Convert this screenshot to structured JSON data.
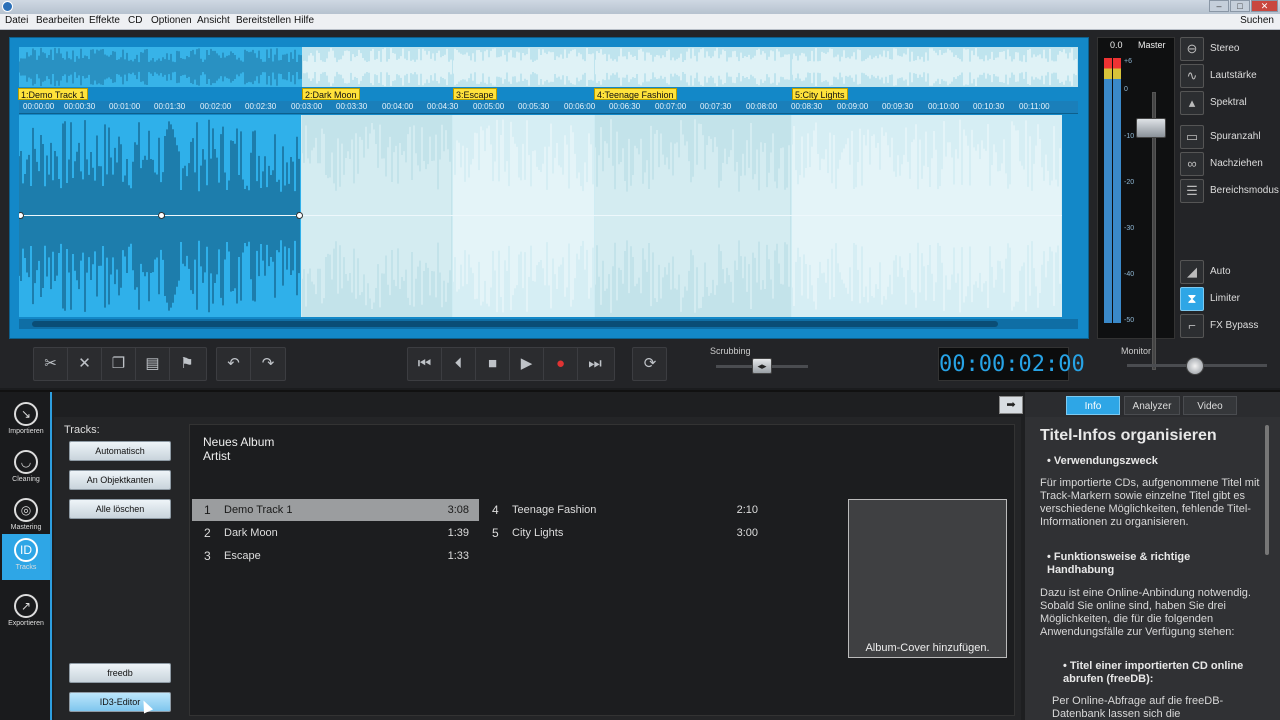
{
  "menu": {
    "items": [
      "Datei",
      "Bearbeiten",
      "Effekte",
      "CD",
      "Optionen",
      "Ansicht",
      "Bereitstellen",
      "Hilfe"
    ],
    "search": "Suchen"
  },
  "tracks": [
    {
      "marker": "1:Demo Track 1",
      "num": "1",
      "name": "Demo Track 1",
      "duration": "3:08",
      "selected": true
    },
    {
      "marker": "2:Dark Moon",
      "num": "2",
      "name": "Dark Moon",
      "duration": "1:39"
    },
    {
      "marker": "3:Escape",
      "num": "3",
      "name": "Escape",
      "duration": "1:33"
    },
    {
      "marker": "4:Teenage Fashion",
      "num": "4",
      "name": "Teenage Fashion",
      "duration": "2:10"
    },
    {
      "marker": "5:City Lights",
      "num": "5",
      "name": "City Lights",
      "duration": "3:00"
    }
  ],
  "ruler": {
    "ticks": [
      "00:00:00",
      "00:00:30",
      "00:01:00",
      "00:01:30",
      "00:02:00",
      "00:02:30",
      "00:03:00",
      "00:03:30",
      "00:04:00",
      "00:04:30",
      "00:05:00",
      "00:05:30",
      "00:06:00",
      "00:06:30",
      "00:07:00",
      "00:07:30",
      "00:08:00",
      "00:08:30",
      "00:09:00",
      "00:09:30",
      "00:10:00",
      "00:10:30",
      "00:11:00"
    ]
  },
  "meter": {
    "peak": "0.0",
    "master_label": "Master",
    "scale": [
      "+6",
      "0",
      "-10",
      "-20",
      "-30",
      "-40",
      "-50"
    ]
  },
  "side_buttons": {
    "stereo": "Stereo",
    "volume": "Lautstärke",
    "spectral": "Spektral",
    "track_count": "Spuranzahl",
    "follow": "Nachziehen",
    "range_mode": "Bereichsmodus",
    "auto": "Auto",
    "limiter": "Limiter",
    "fx_bypass": "FX Bypass"
  },
  "transport": {
    "scrubbing_label": "Scrubbing",
    "timecode": "00:00:02:00",
    "monitor_label": "Monitor"
  },
  "nav": {
    "import": "Importieren",
    "cleaning": "Cleaning",
    "mastering": "Mastering",
    "tracks": "Tracks",
    "export": "Exportieren"
  },
  "tracks_panel": {
    "heading": "Tracks:",
    "auto_btn": "Automatisch",
    "object_edges_btn": "An Objektkanten",
    "delete_all_btn": "Alle löschen",
    "freedb_btn": "freedb",
    "id3_btn": "ID3-Editor"
  },
  "album": {
    "title": "Neues Album",
    "artist": "Artist",
    "cover_prompt": "Album-Cover hinzufügen."
  },
  "info": {
    "tabs": [
      "Info",
      "Analyzer",
      "Video"
    ],
    "title": "Titel-Infos organisieren",
    "bullet1": "• Verwendungszweck",
    "para1": "Für importierte CDs, aufgenommene Titel mit Track-Markern sowie einzelne Titel gibt es verschiedene Möglichkeiten, fehlende Titel-Informationen zu organisieren.",
    "bullet2": "• Funktionsweise & richtige Handhabung",
    "para2": "Dazu ist eine Online-Anbindung notwendig. Sobald Sie online sind, haben Sie drei Möglichkeiten, die für die folgenden Anwendungsfälle zur Verfügung stehen:",
    "bullet3": "• Titel einer importierten CD online abrufen (freeDB):",
    "para3": "Per Online-Abfrage auf die freeDB-Datenbank lassen sich die"
  }
}
